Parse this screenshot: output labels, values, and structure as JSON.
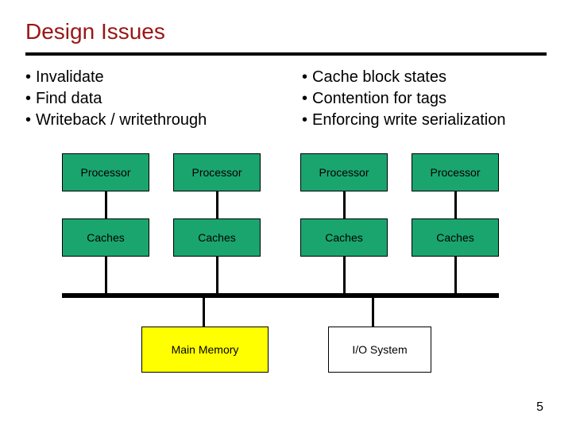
{
  "title": "Design Issues",
  "bullets_left": [
    "Invalidate",
    "Find data",
    "Writeback / writethrough"
  ],
  "bullets_right": [
    "Cache block states",
    "Contention for tags",
    "Enforcing write serialization"
  ],
  "labels": {
    "processor": "Processor",
    "caches": "Caches",
    "main_memory": "Main Memory",
    "io_system": "I/O System"
  },
  "page_number": "5",
  "colors": {
    "title": "#9a1616",
    "processor_fill": "#1aa56f",
    "caches_fill": "#1aa56f",
    "memory_fill": "#ffff00",
    "io_fill": "#ffffff"
  },
  "chart_data": {
    "type": "diagram",
    "title": "Design Issues",
    "nodes": [
      {
        "id": "p1",
        "label": "Processor",
        "row": 0,
        "col": 0,
        "fill": "green"
      },
      {
        "id": "p2",
        "label": "Processor",
        "row": 0,
        "col": 1,
        "fill": "green"
      },
      {
        "id": "p3",
        "label": "Processor",
        "row": 0,
        "col": 2,
        "fill": "green"
      },
      {
        "id": "p4",
        "label": "Processor",
        "row": 0,
        "col": 3,
        "fill": "green"
      },
      {
        "id": "c1",
        "label": "Caches",
        "row": 1,
        "col": 0,
        "fill": "green"
      },
      {
        "id": "c2",
        "label": "Caches",
        "row": 1,
        "col": 1,
        "fill": "green"
      },
      {
        "id": "c3",
        "label": "Caches",
        "row": 1,
        "col": 2,
        "fill": "green"
      },
      {
        "id": "c4",
        "label": "Caches",
        "row": 1,
        "col": 3,
        "fill": "green"
      },
      {
        "id": "mm",
        "label": "Main Memory",
        "row": 3,
        "col": 1,
        "fill": "yellow"
      },
      {
        "id": "io",
        "label": "I/O System",
        "row": 3,
        "col": 2,
        "fill": "white"
      }
    ],
    "edges": [
      {
        "from": "p1",
        "to": "c1"
      },
      {
        "from": "p2",
        "to": "c2"
      },
      {
        "from": "p3",
        "to": "c3"
      },
      {
        "from": "p4",
        "to": "c4"
      },
      {
        "from": "c1",
        "to": "bus"
      },
      {
        "from": "c2",
        "to": "bus"
      },
      {
        "from": "c3",
        "to": "bus"
      },
      {
        "from": "c4",
        "to": "bus"
      },
      {
        "from": "bus",
        "to": "mm"
      },
      {
        "from": "bus",
        "to": "io"
      }
    ],
    "bus": {
      "type": "horizontal-bus",
      "row": 2
    }
  }
}
